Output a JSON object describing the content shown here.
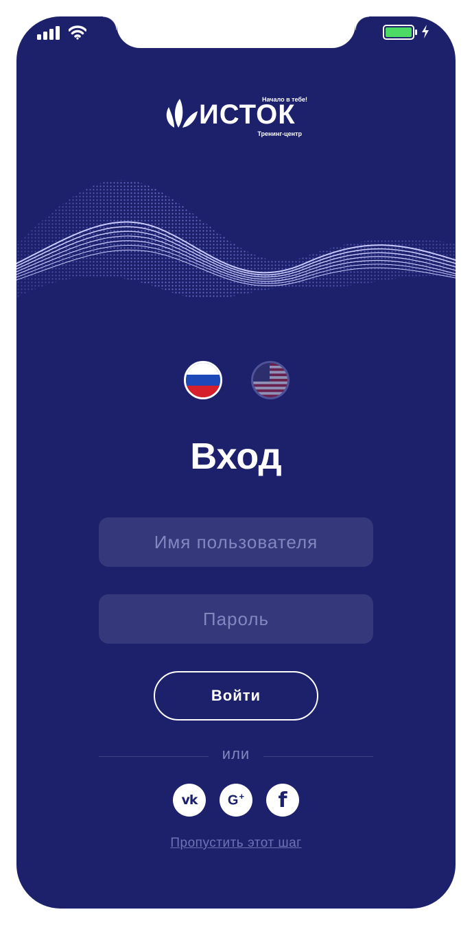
{
  "status_bar": {
    "signal_icon": "cellular-signal-icon",
    "wifi_icon": "wifi-icon",
    "battery_icon": "battery-full-icon",
    "charging_icon": "charging-bolt-icon"
  },
  "brand": {
    "name": "ИСТОК",
    "tagline": "Начало в тебе!",
    "subtitle": "Тренинг-центр"
  },
  "languages": [
    {
      "code": "ru",
      "icon": "russia-flag-icon",
      "selected": true
    },
    {
      "code": "en",
      "icon": "usa-flag-icon",
      "selected": false
    }
  ],
  "login": {
    "title": "Вход",
    "username_placeholder": "Имя пользователя",
    "password_placeholder": "Пароль",
    "submit_label": "Войти",
    "or_label": "или",
    "social": {
      "vk_label": "vk",
      "google_label": "G",
      "google_plus": "+",
      "facebook_label": "f"
    },
    "skip_label": "Пропустить этот шаг"
  },
  "colors": {
    "background": "#1d216c",
    "field": "#35397b",
    "placeholder": "#8387c0",
    "battery": "#4cd964",
    "wave": "#c9caff"
  }
}
